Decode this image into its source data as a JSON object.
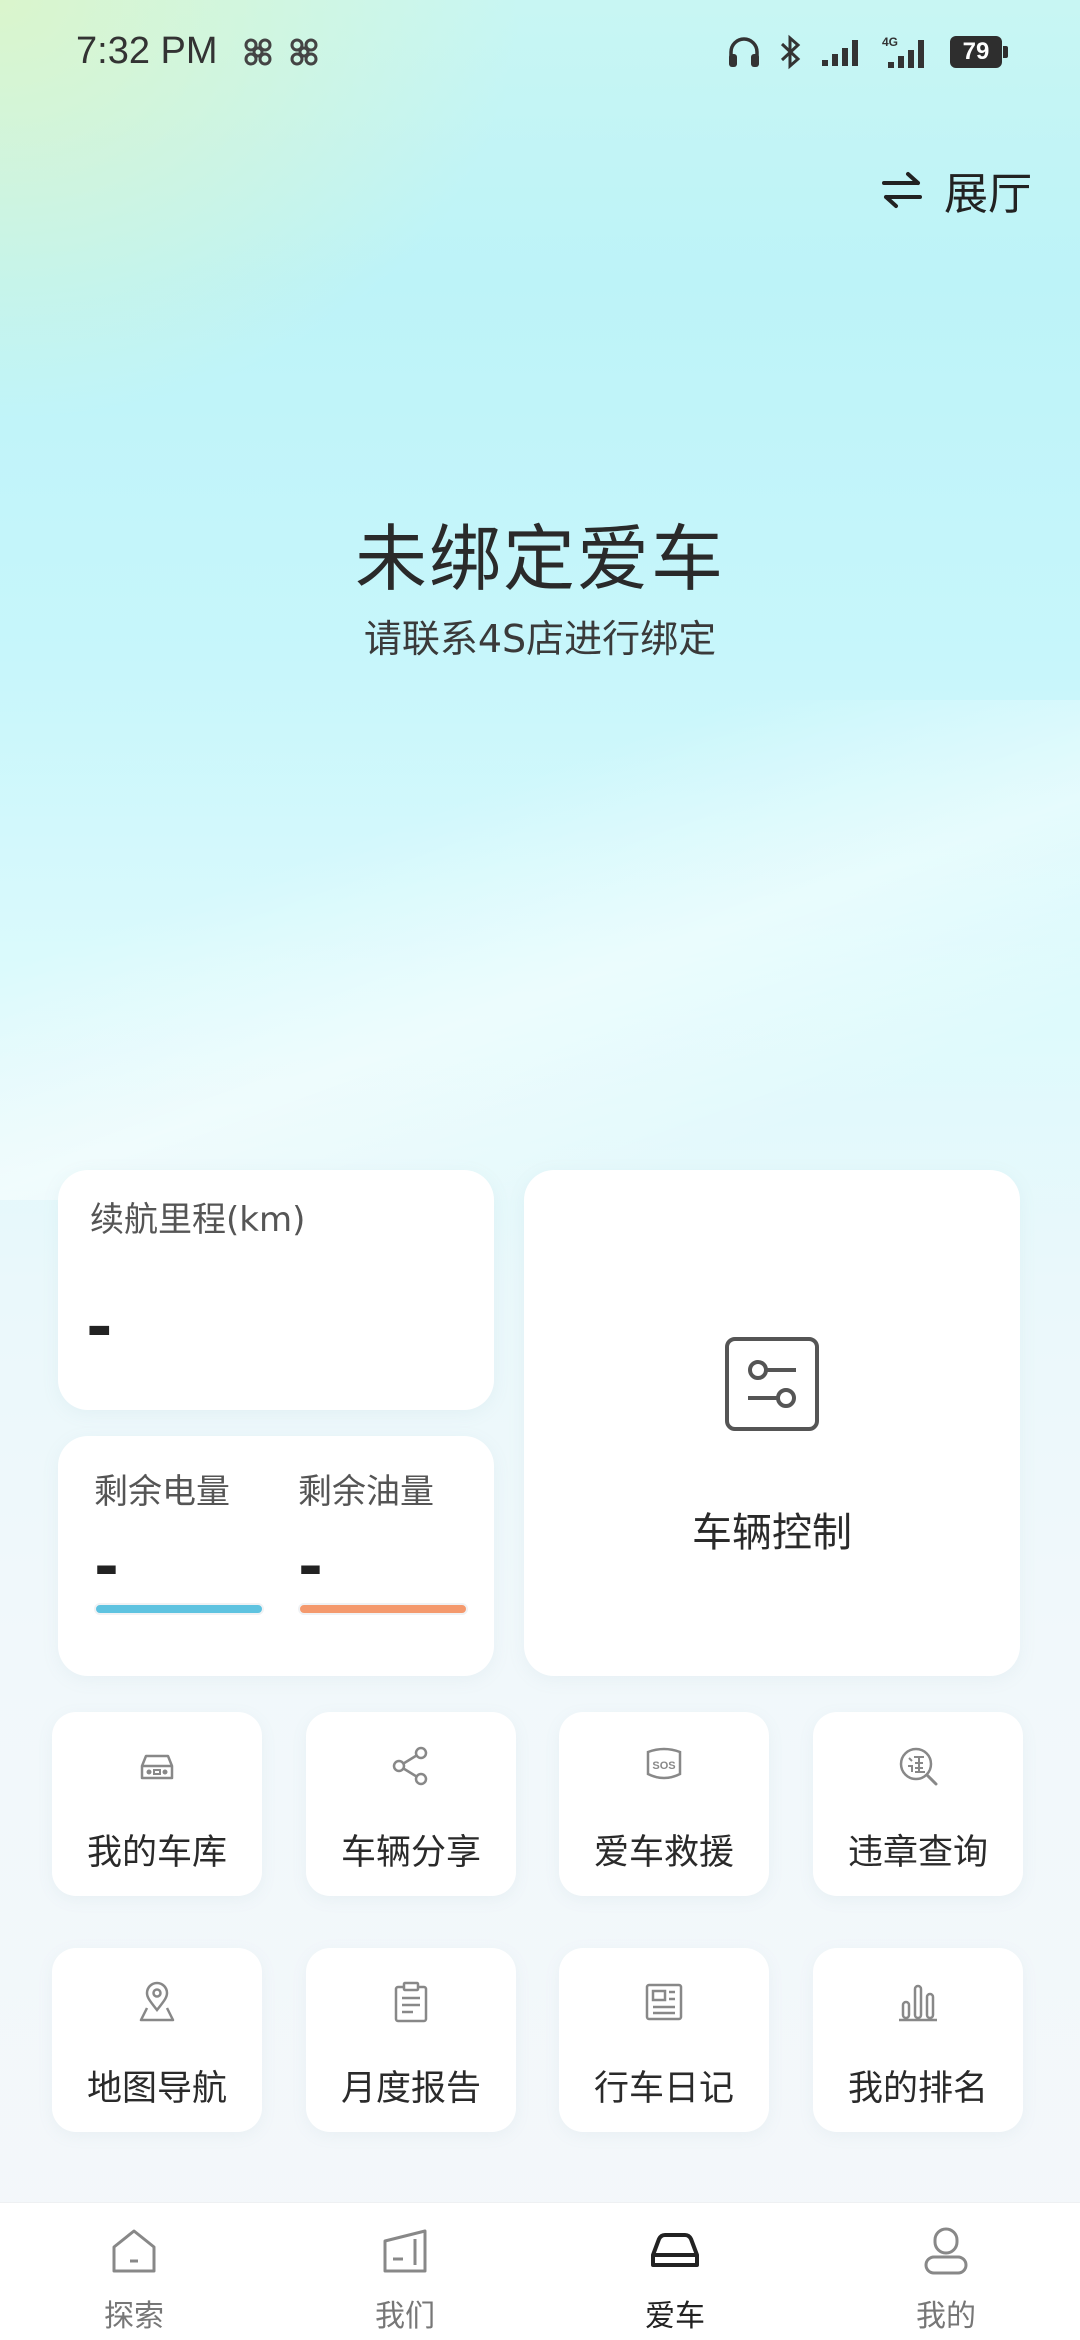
{
  "status_bar": {
    "time": "7:32 PM",
    "battery": "79",
    "network": "4G",
    "icons": [
      "china-unicom-icon",
      "china-unicom-icon",
      "headphones-icon",
      "bluetooth-icon",
      "signal-icon",
      "signal-icon",
      "battery-icon"
    ]
  },
  "header": {
    "switch_label": "展厅",
    "switch_icon": "swap-icon"
  },
  "hero": {
    "title": "未绑定爱车",
    "subtitle": "请联系4S店进行绑定"
  },
  "range_card": {
    "label": "续航里程(km)",
    "value": "-"
  },
  "energy_card": {
    "battery_label": "剩余电量",
    "battery_value": "-",
    "battery_color": "#5ec3e0",
    "fuel_label": "剩余油量",
    "fuel_value": "-",
    "fuel_color": "#f4996d"
  },
  "control_card": {
    "label": "车辆控制",
    "icon": "sliders-icon"
  },
  "services": [
    {
      "label": "我的车库",
      "icon": "garage-car-icon"
    },
    {
      "label": "车辆分享",
      "icon": "share-icon"
    },
    {
      "label": "爱车救援",
      "icon": "sos-icon"
    },
    {
      "label": "违章查询",
      "icon": "violation-search-icon"
    },
    {
      "label": "地图导航",
      "icon": "map-pin-icon"
    },
    {
      "label": "月度报告",
      "icon": "clipboard-icon"
    },
    {
      "label": "行车日记",
      "icon": "newspaper-icon"
    },
    {
      "label": "我的排名",
      "icon": "bar-chart-icon"
    }
  ],
  "bottom_nav": [
    {
      "label": "探索",
      "icon": "home-icon",
      "active": false
    },
    {
      "label": "我们",
      "icon": "building-icon",
      "active": false
    },
    {
      "label": "爱车",
      "icon": "car-icon",
      "active": true
    },
    {
      "label": "我的",
      "icon": "profile-icon",
      "active": false
    }
  ],
  "colors": {
    "accent_blue": "#5ec3e0",
    "accent_orange": "#f4996d",
    "icon_gray": "#888888"
  }
}
